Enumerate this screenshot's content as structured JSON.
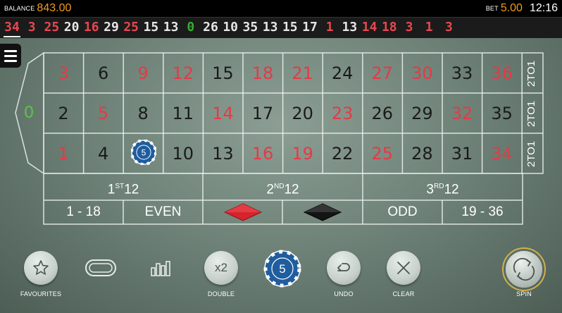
{
  "topbar": {
    "balance_label": "BALANCE",
    "balance_value": "843.00",
    "bet_label": "BET",
    "bet_value": "5.00",
    "clock": "12:16"
  },
  "history": [
    {
      "n": "34",
      "color": "red"
    },
    {
      "n": "3",
      "color": "red"
    },
    {
      "n": "25",
      "color": "red"
    },
    {
      "n": "20",
      "color": "black"
    },
    {
      "n": "16",
      "color": "red"
    },
    {
      "n": "29",
      "color": "black"
    },
    {
      "n": "25",
      "color": "red"
    },
    {
      "n": "15",
      "color": "black"
    },
    {
      "n": "13",
      "color": "black"
    },
    {
      "n": "0",
      "color": "green"
    },
    {
      "n": "26",
      "color": "black"
    },
    {
      "n": "10",
      "color": "black"
    },
    {
      "n": "35",
      "color": "black"
    },
    {
      "n": "13",
      "color": "black"
    },
    {
      "n": "15",
      "color": "black"
    },
    {
      "n": "17",
      "color": "black"
    },
    {
      "n": "1",
      "color": "red"
    },
    {
      "n": "13",
      "color": "black"
    },
    {
      "n": "14",
      "color": "red"
    },
    {
      "n": "18",
      "color": "red"
    },
    {
      "n": "3",
      "color": "red"
    },
    {
      "n": "1",
      "color": "red"
    },
    {
      "n": "3",
      "color": "red"
    }
  ],
  "table": {
    "zero": "0",
    "rows": [
      [
        {
          "n": "3",
          "c": "red"
        },
        {
          "n": "6",
          "c": "black"
        },
        {
          "n": "9",
          "c": "red"
        },
        {
          "n": "12",
          "c": "red"
        },
        {
          "n": "15",
          "c": "black"
        },
        {
          "n": "18",
          "c": "red"
        },
        {
          "n": "21",
          "c": "red"
        },
        {
          "n": "24",
          "c": "black"
        },
        {
          "n": "27",
          "c": "red"
        },
        {
          "n": "30",
          "c": "red"
        },
        {
          "n": "33",
          "c": "black"
        },
        {
          "n": "36",
          "c": "red"
        }
      ],
      [
        {
          "n": "2",
          "c": "black"
        },
        {
          "n": "5",
          "c": "red"
        },
        {
          "n": "8",
          "c": "black"
        },
        {
          "n": "11",
          "c": "black"
        },
        {
          "n": "14",
          "c": "red"
        },
        {
          "n": "17",
          "c": "black"
        },
        {
          "n": "20",
          "c": "black"
        },
        {
          "n": "23",
          "c": "red"
        },
        {
          "n": "26",
          "c": "black"
        },
        {
          "n": "29",
          "c": "black"
        },
        {
          "n": "32",
          "c": "red"
        },
        {
          "n": "35",
          "c": "black"
        }
      ],
      [
        {
          "n": "1",
          "c": "red"
        },
        {
          "n": "4",
          "c": "black"
        },
        {
          "n": "7",
          "c": "red"
        },
        {
          "n": "10",
          "c": "black"
        },
        {
          "n": "13",
          "c": "black"
        },
        {
          "n": "16",
          "c": "red"
        },
        {
          "n": "19",
          "c": "red"
        },
        {
          "n": "22",
          "c": "black"
        },
        {
          "n": "25",
          "c": "red"
        },
        {
          "n": "28",
          "c": "black"
        },
        {
          "n": "31",
          "c": "black"
        },
        {
          "n": "34",
          "c": "red"
        }
      ]
    ],
    "column_bet": "2TO1",
    "dozens": [
      {
        "num": "1",
        "sup": "ST",
        "suffix": "12"
      },
      {
        "num": "2",
        "sup": "ND",
        "suffix": "12"
      },
      {
        "num": "3",
        "sup": "RD",
        "suffix": "12"
      }
    ],
    "outside": {
      "low": "1 - 18",
      "even": "EVEN",
      "odd": "ODD",
      "high": "19 - 36"
    },
    "placed_chip": {
      "number": "7",
      "value": "5"
    }
  },
  "controls": {
    "favourites": "FAVOURITES",
    "double": "DOUBLE",
    "double_symbol": "x2",
    "chip_value": "5",
    "undo": "UNDO",
    "clear": "CLEAR",
    "spin": "SPIN"
  },
  "colors": {
    "red": "#e53a44",
    "black": "#1a1a1a",
    "green": "#5ec34a",
    "accent": "#f39a1e",
    "chip": "#1f5d9e",
    "spin_ring": "#d4b04a"
  }
}
